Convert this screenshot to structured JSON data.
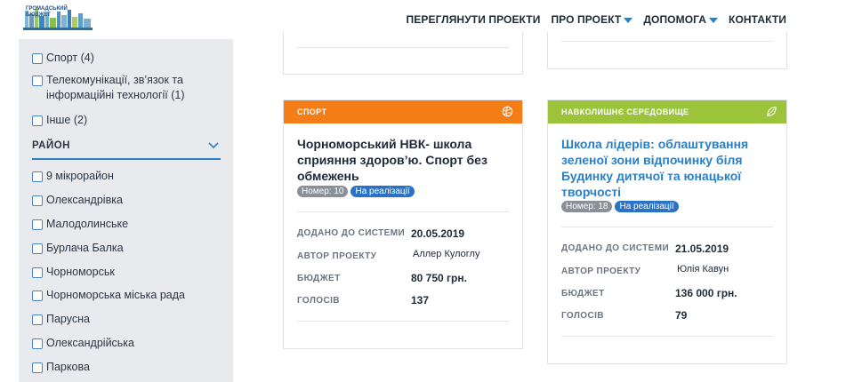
{
  "header": {
    "logo_text": "ГРОМАДСЬКИЙ БЮДЖЕТ",
    "nav": [
      {
        "label": "ПЕРЕГЛЯНУТИ ПРОЕКТИ",
        "dropdown": false
      },
      {
        "label": "ПРО ПРОЕКТ",
        "dropdown": true
      },
      {
        "label": "ДОПОМОГА",
        "dropdown": true
      },
      {
        "label": "КОНТАКТИ",
        "dropdown": false
      }
    ]
  },
  "sidebar": {
    "categories": [
      "Спорт (4)",
      "Телекомунікації, зв’язок та інформаційні технології (1)",
      "Інше (2)"
    ],
    "district_header": "РАЙОН",
    "districts": [
      "9 мікрорайон",
      "Олександрівка",
      "Малодолинське",
      "Бурлача Балка",
      "Чорноморськ",
      "Чорноморська міська рада",
      "Парусна",
      "Олександрійська",
      "Паркова"
    ]
  },
  "colors": {
    "sport_band": "#f47d17",
    "environment_band": "#9bc43b",
    "link_blue": "#2a7fc6"
  },
  "cards": [
    {
      "category": "СПОРТ",
      "category_icon": "volleyball-icon",
      "title": "Чорноморський НВК- школа сприяння здоров’ю. Спорт без обмежень",
      "number": "Номер: 10",
      "status": "На реалізації",
      "added_label": "ДОДАНО ДО СИСТЕМИ",
      "added_value": "20.05.2019",
      "author_label": "АВТОР ПРОЕКТУ",
      "author_value": "Аллер Кулоглу",
      "budget_label": "БЮДЖЕТ",
      "budget_value": "80 750 грн.",
      "votes_label": "ГОЛОСІВ",
      "votes_value": "137"
    },
    {
      "category": "НАВКОЛИШНЄ СЕРЕДОВИЩЕ",
      "category_icon": "leaf-icon",
      "title": "Школа лідерів: облаштування зеленої зони відпочинку біля Будинку дитячої та юнацької творчості",
      "number": "Номер: 18",
      "status": "На реалізації",
      "added_label": "ДОДАНО ДО СИСТЕМИ",
      "added_value": "21.05.2019",
      "author_label": "АВТОР ПРОЕКТУ",
      "author_value": "Юлія Кавун",
      "budget_label": "БЮДЖЕТ",
      "budget_value": "136 000 грн.",
      "votes_label": "ГОЛОСІВ",
      "votes_value": "79"
    }
  ]
}
